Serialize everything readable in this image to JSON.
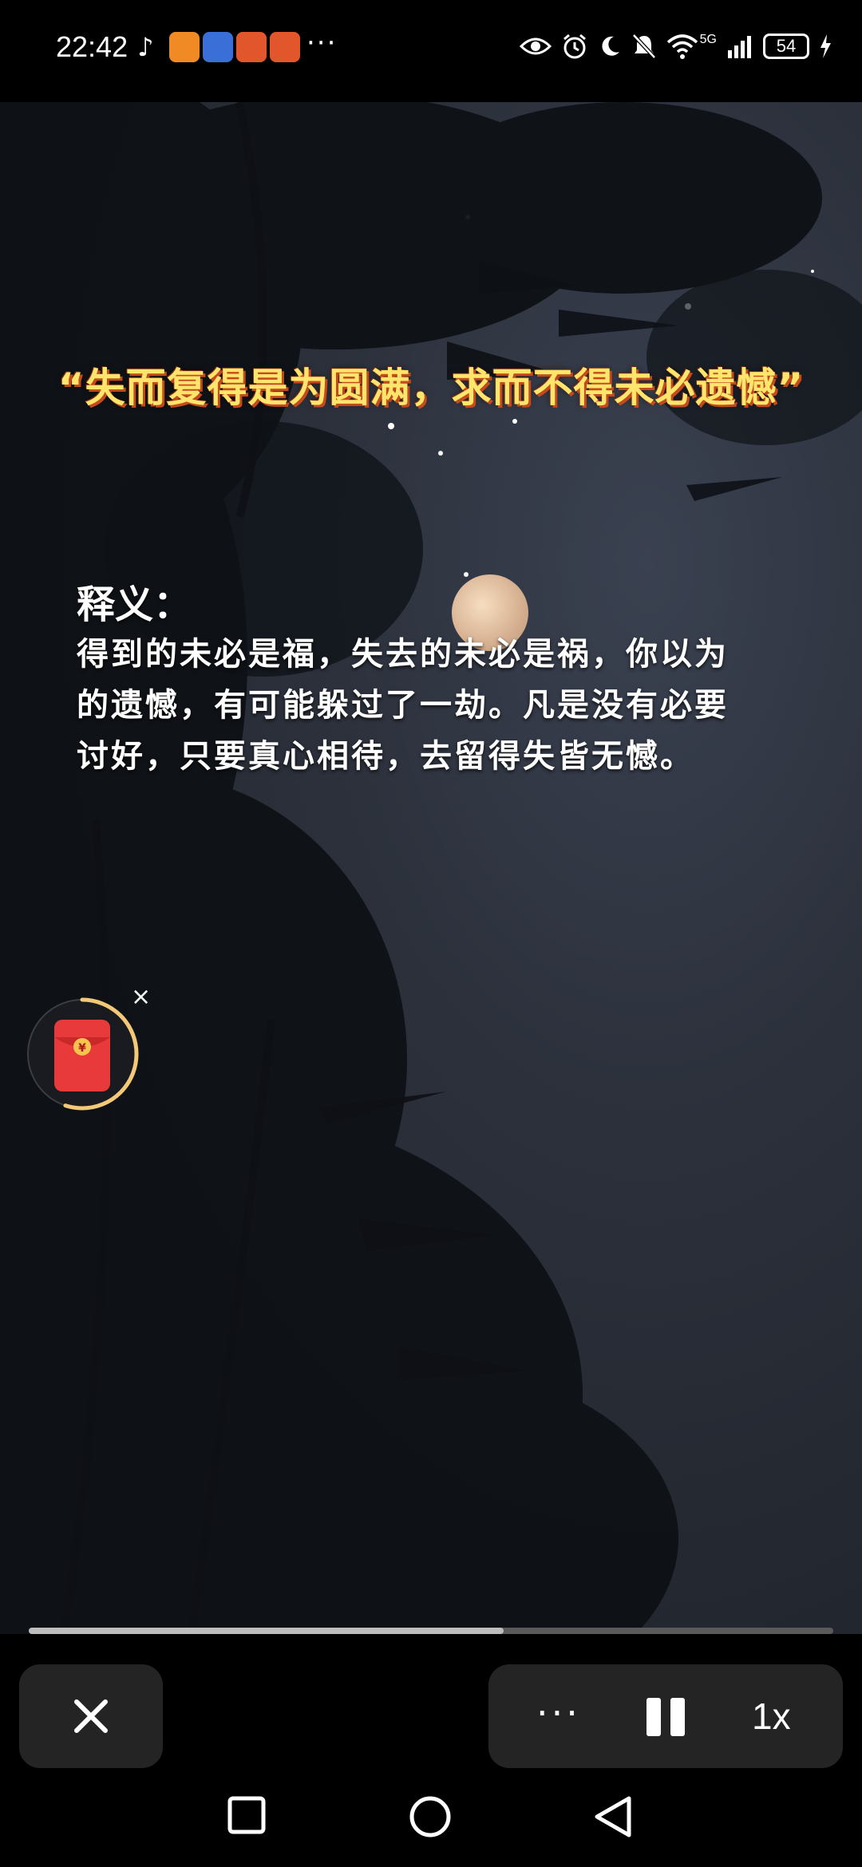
{
  "status_bar": {
    "time": "22:42",
    "more": "···",
    "battery": "54",
    "network": "5G",
    "app_icons": [
      "tiktok-icon",
      "orange-app-icon",
      "blue-app-icon",
      "weibo-icon",
      "weibo-icon"
    ],
    "right_icons": [
      "eye-icon",
      "alarm-icon",
      "moon-icon",
      "mute-icon",
      "wifi-icon",
      "signal-icon",
      "battery-icon",
      "charging-icon"
    ]
  },
  "video": {
    "quote": "“失而复得是为圆满，求而不得未必遗憾”",
    "meaning_title": "释义：",
    "meaning_lines": [
      "得到的未必是福，失去的未必是祸，你以为",
      "的遗憾，有可能躲过了一劫。凡是没有必要",
      "讨好，只要真心相待，去留得失皆无憾。"
    ]
  },
  "envelope": {
    "symbol": "¥",
    "close": "×",
    "progress": 0.55
  },
  "playback": {
    "progress": 0.59,
    "more_label": "···",
    "speed_label": "1x"
  },
  "colors": {
    "quote": "#ffe56b",
    "envelope_red": "#e83a3a",
    "ring": "#f3c978"
  }
}
